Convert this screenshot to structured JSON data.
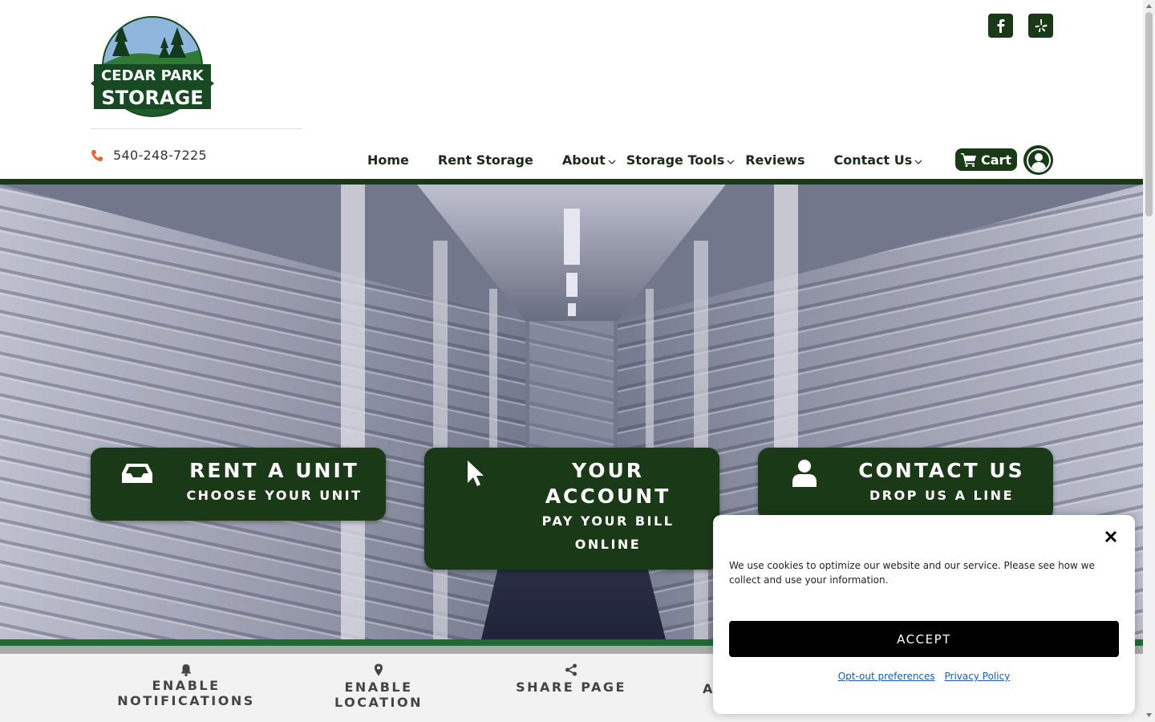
{
  "brand": {
    "line1": "CEDAR PARK",
    "line2": "STORAGE"
  },
  "header": {
    "phone": "540-248-7225"
  },
  "social": [
    {
      "name": "facebook-icon"
    },
    {
      "name": "yelp-icon"
    }
  ],
  "nav": {
    "items": [
      {
        "label": "Home",
        "dropdown": false
      },
      {
        "label": "Rent Storage",
        "dropdown": false
      },
      {
        "label": "About",
        "dropdown": true
      },
      {
        "label": "Storage Tools",
        "dropdown": true
      },
      {
        "label": "Reviews",
        "dropdown": false
      },
      {
        "label": "Contact Us",
        "dropdown": true
      }
    ],
    "cart_label": "Cart"
  },
  "cta": [
    {
      "title": "RENT A UNIT",
      "subtitle": "CHOOSE YOUR UNIT",
      "icon": "inbox-icon"
    },
    {
      "title_line1": "YOUR",
      "title_line2": "ACCOUNT",
      "subtitle_line1": "PAY YOUR BILL",
      "subtitle_line2": "ONLINE",
      "icon": "mouse-pointer-icon"
    },
    {
      "title": "CONTACT US",
      "subtitle": "DROP US A LINE",
      "icon": "user-icon"
    }
  ],
  "toolbar": {
    "notifications_line1": "ENABLE",
    "notifications_line2": "NOTIFICATIONS",
    "location": "ENABLE LOCATION",
    "share": "SHARE PAGE",
    "partial": "A"
  },
  "cookie": {
    "text": "We use cookies to optimize our website and our service. Please see how we collect and use your information.",
    "accept": "ACCEPT",
    "optout": "Opt-out preferences",
    "privacy": "Privacy Policy"
  },
  "colors": {
    "brand_green": "#1a3a17",
    "accent_green": "#1f6b33",
    "phone_icon": "#e8642a"
  }
}
